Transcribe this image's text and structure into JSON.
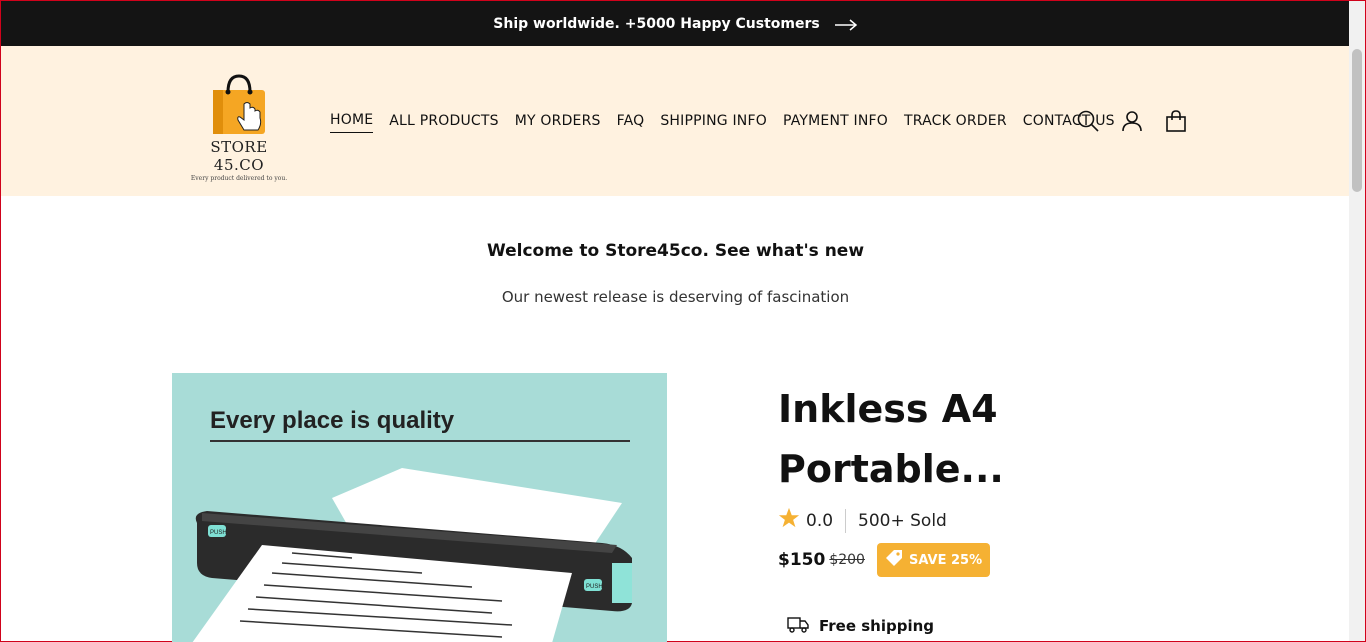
{
  "announcement": {
    "text": "Ship worldwide. +5000 Happy Customers",
    "arrow_icon": "arrow-right-icon"
  },
  "logo": {
    "brand": "STORE 45.CO",
    "tagline": "Every product delivered to you.",
    "icon": "shopping-bag-hand-icon",
    "bag_color": "#f5a623"
  },
  "nav": {
    "items": [
      {
        "label": "HOME",
        "active": true
      },
      {
        "label": "ALL PRODUCTS"
      },
      {
        "label": "MY ORDERS"
      },
      {
        "label": "FAQ"
      },
      {
        "label": "SHIPPING INFO"
      },
      {
        "label": "PAYMENT INFO"
      },
      {
        "label": "TRACK ORDER"
      },
      {
        "label": "CONTACT US"
      }
    ],
    "icons": [
      "search-icon",
      "account-icon",
      "cart-icon"
    ]
  },
  "hero": {
    "heading": "Welcome to Store45co. See what's new",
    "subheading": "Our newest release is deserving of fascination"
  },
  "product": {
    "image_caption": "Every place is quality",
    "image_button_left": "PUSH",
    "image_button_right": "PUSH",
    "title": "Inkless A4 Portable...",
    "rating": "0.0",
    "sold": "500+ Sold",
    "price": "$150",
    "compare_price": "$200",
    "save_badge": "SAVE 25%",
    "shipping": "Free shipping"
  },
  "colors": {
    "announcement_bg": "#141414",
    "header_bg": "#fff2e0",
    "badge": "#f5b133",
    "star": "#f5b133",
    "image_bg": "#a8dcd7"
  }
}
